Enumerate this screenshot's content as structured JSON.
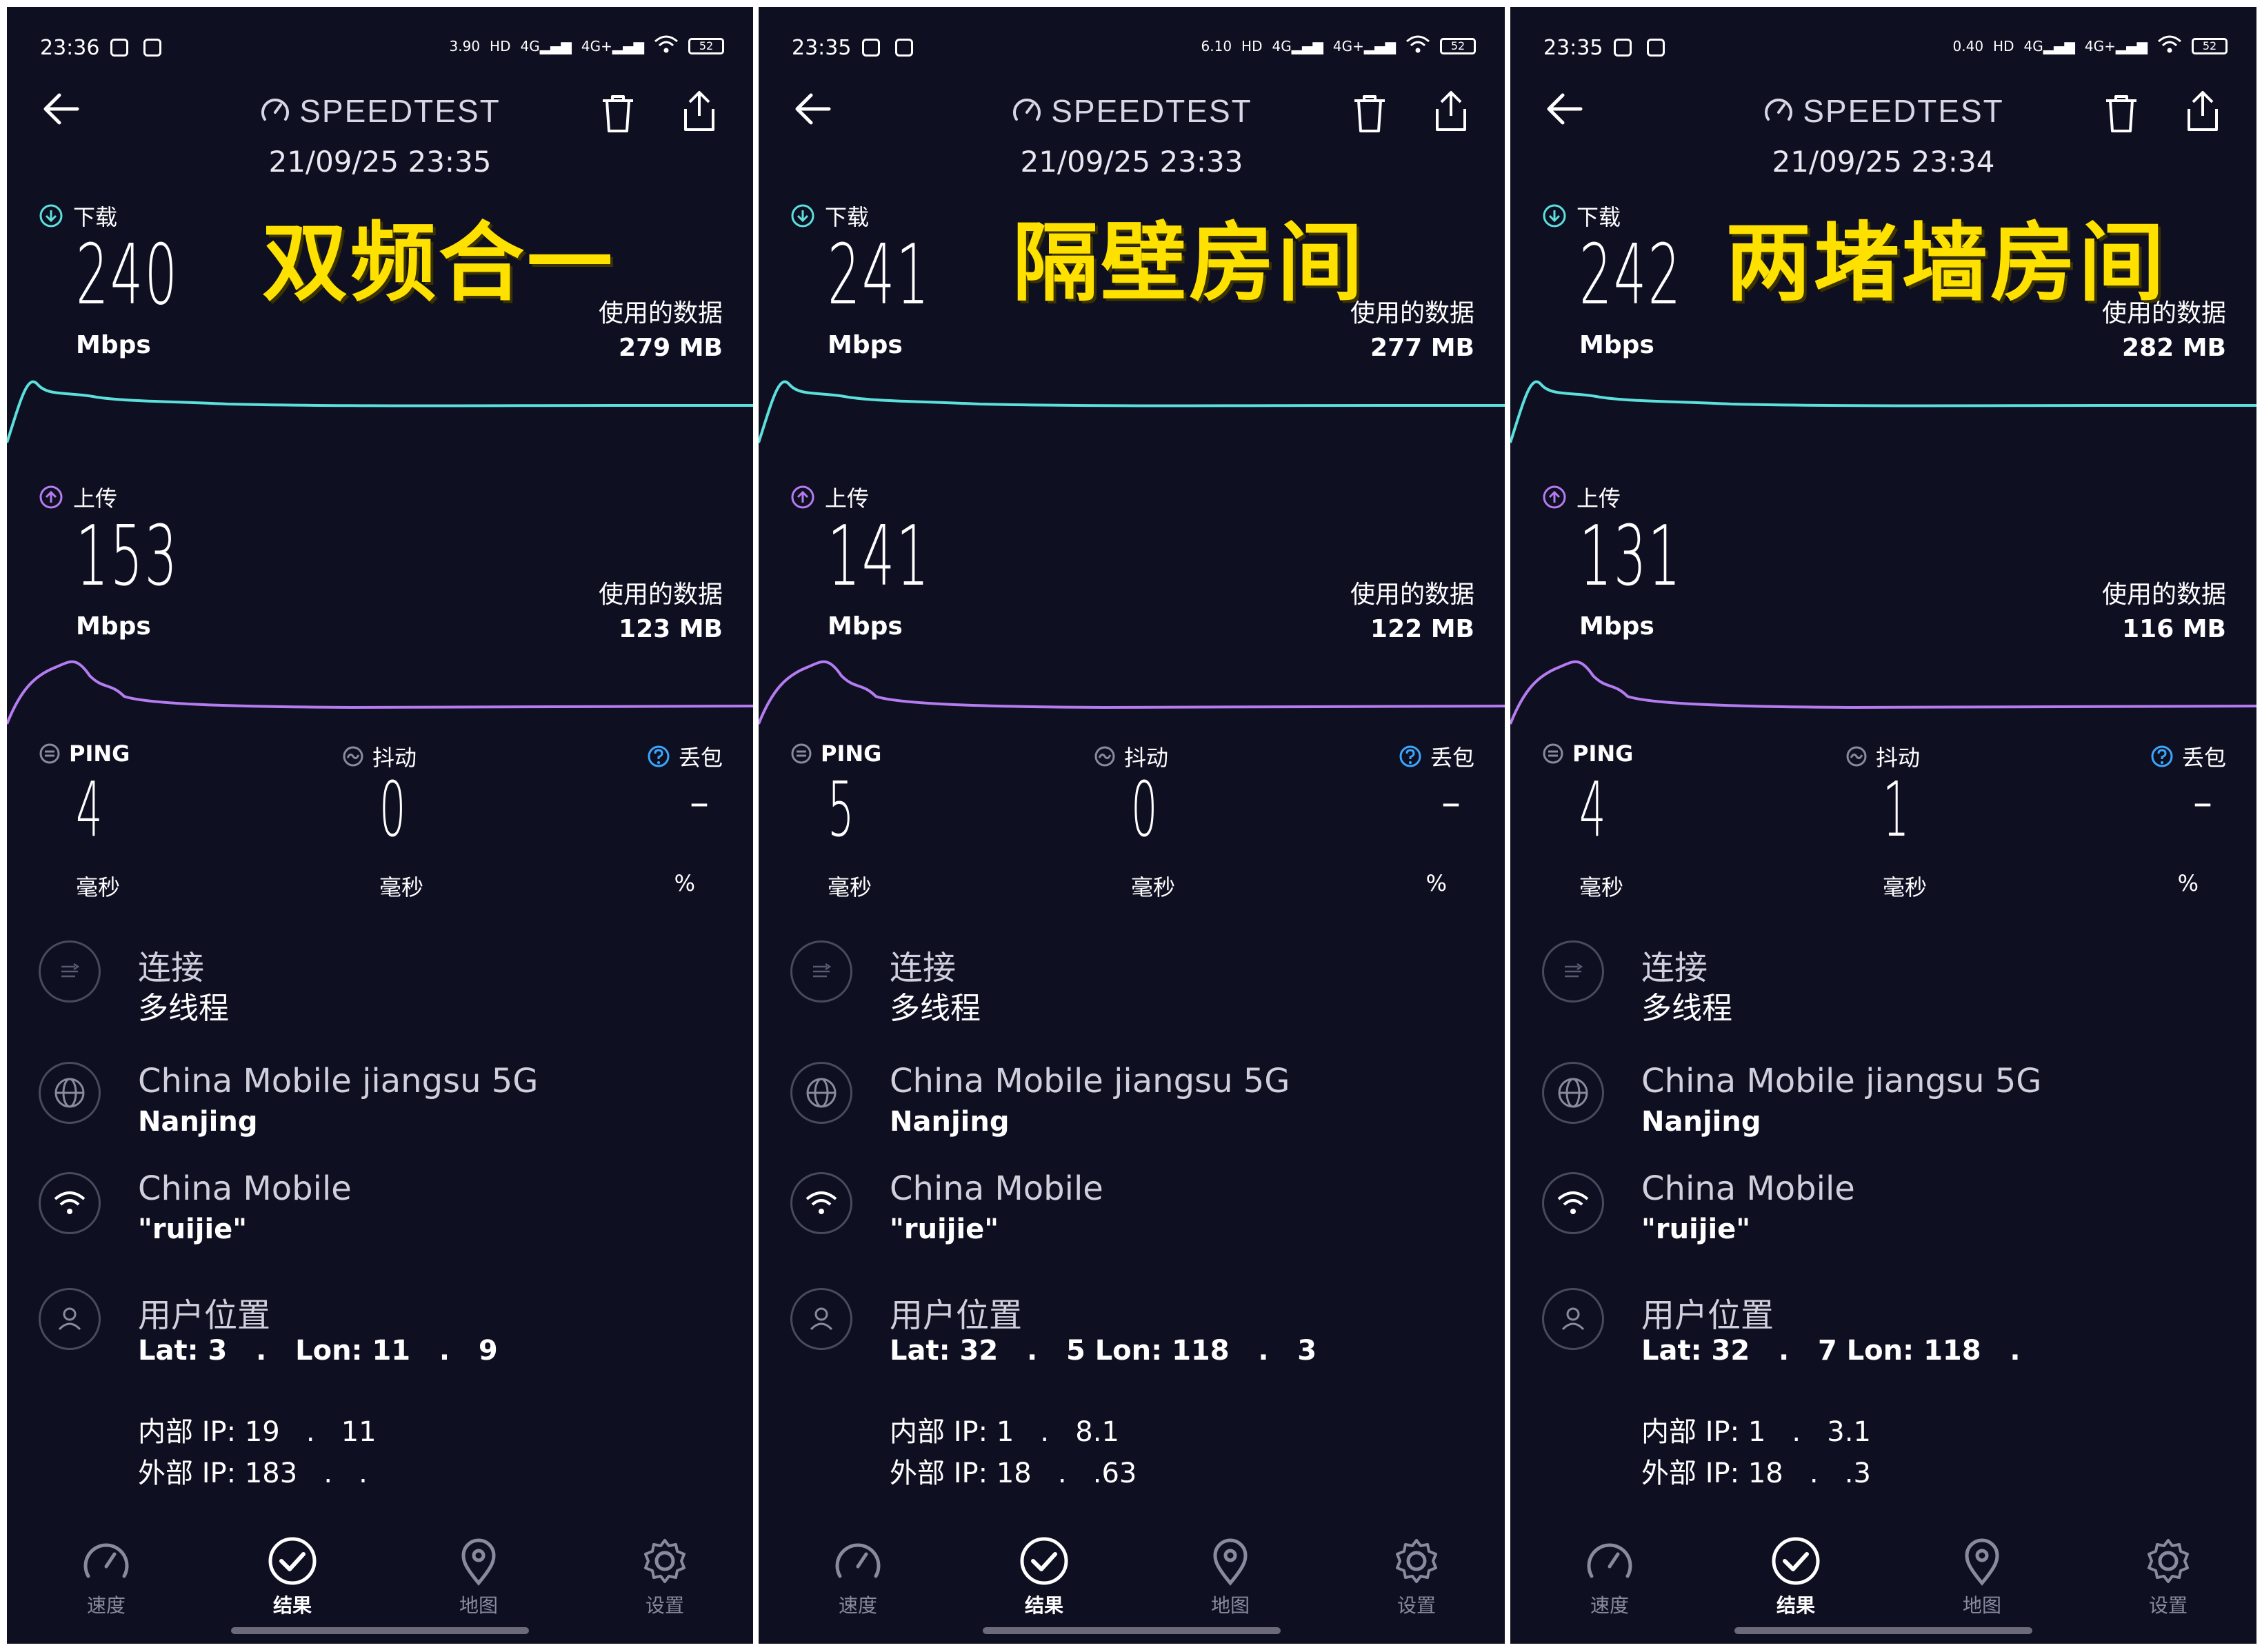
{
  "common": {
    "app_name": "SPEEDTEST",
    "download_label": "下载",
    "upload_label": "上传",
    "mbps": "Mbps",
    "used_data_label": "使用的数据",
    "ping_label": "PING",
    "jitter_label": "抖动",
    "loss_label": "丢包",
    "ms": "毫秒",
    "percent": "%",
    "connection_title": "连接",
    "connection_value": "多线程",
    "server_name": "China Mobile jiangsu 5G",
    "server_city": "Nanjing",
    "provider": "China Mobile",
    "wifi_name": "\"ruijie\"",
    "location_title": "用户位置",
    "nav": [
      "速度",
      "结果",
      "地图",
      "设置"
    ],
    "colors": {
      "download": "#5ce0dc",
      "upload": "#b57cf0",
      "overlay": "#ffe100",
      "bg": "#0f0f22"
    }
  },
  "panels": [
    {
      "status_time": "23:36",
      "net_speed": "3.90",
      "battery": "52",
      "datetime": "21/09/25 23:35",
      "overlay": "双频合一",
      "download": "240",
      "download_used": "279 MB",
      "upload": "153",
      "upload_used": "123 MB",
      "ping": "4",
      "jitter": "0",
      "loss": "–",
      "lat_line": "Lat: 3   .   Lon: 11   .   9",
      "internal_ip": "内部 IP: 19   .   11",
      "external_ip": "外部 IP: 183   .   ."
    },
    {
      "status_time": "23:35",
      "net_speed": "6.10",
      "battery": "52",
      "datetime": "21/09/25 23:33",
      "overlay": "隔壁房间",
      "download": "241",
      "download_used": "277 MB",
      "upload": "141",
      "upload_used": "122 MB",
      "ping": "5",
      "jitter": "0",
      "loss": "–",
      "lat_line": "Lat: 32   .   5 Lon: 118   .   3",
      "internal_ip": "内部 IP: 1   .   8.1",
      "external_ip": "外部 IP: 18   .   .63"
    },
    {
      "status_time": "23:35",
      "net_speed": "0.40",
      "battery": "52",
      "datetime": "21/09/25 23:34",
      "overlay": "两堵墙房间",
      "download": "242",
      "download_used": "282 MB",
      "upload": "131",
      "upload_used": "116 MB",
      "ping": "4",
      "jitter": "1",
      "loss": "–",
      "lat_line": "Lat: 32   .   7 Lon: 118   .",
      "internal_ip": "内部 IP: 1   .   3.1",
      "external_ip": "外部 IP: 18   .   .3"
    }
  ]
}
